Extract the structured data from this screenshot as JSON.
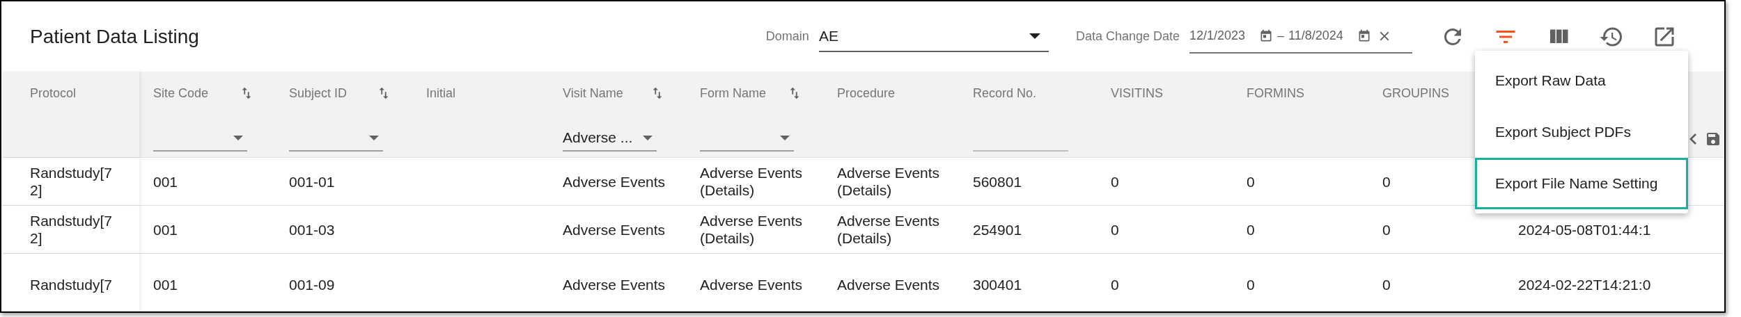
{
  "title": "Patient Data Listing",
  "toolbar": {
    "domain": {
      "label": "Domain",
      "value": "AE"
    },
    "date_range": {
      "label": "Data Change Date",
      "start": "12/1/2023",
      "separator": "–",
      "end": "11/8/2024"
    },
    "buttons": [
      {
        "kind": "refresh",
        "active": false
      },
      {
        "kind": "filter",
        "active": true
      },
      {
        "kind": "columns",
        "active": false
      },
      {
        "kind": "history",
        "active": false
      },
      {
        "kind": "export",
        "active": false
      }
    ]
  },
  "table": {
    "columns": [
      {
        "label": "Protocol",
        "sortable": false,
        "filter": {
          "kind": "none"
        }
      },
      {
        "label": "Site Code",
        "sortable": true,
        "filter": {
          "kind": "select"
        }
      },
      {
        "label": "Subject ID",
        "sortable": true,
        "filter": {
          "kind": "select"
        }
      },
      {
        "label": "Initial",
        "sortable": false,
        "filter": {
          "kind": "none"
        }
      },
      {
        "label": "Visit Name",
        "sortable": true,
        "filter": {
          "kind": "select",
          "value": "Adverse ..."
        }
      },
      {
        "label": "Form Name",
        "sortable": true,
        "filter": {
          "kind": "select"
        }
      },
      {
        "label": "Procedure",
        "sortable": false,
        "filter": {
          "kind": "none"
        }
      },
      {
        "label": "Record No.",
        "sortable": false,
        "filter": {
          "kind": "text"
        }
      },
      {
        "label": "VISITINS",
        "sortable": false,
        "filter": {
          "kind": "none"
        }
      },
      {
        "label": "FORMINS",
        "sortable": false,
        "filter": {
          "kind": "none"
        }
      },
      {
        "label": "GROUPINS",
        "sortable": false,
        "filter": {
          "kind": "none"
        }
      },
      {
        "sortable": false,
        "filter": {
          "kind": "actions"
        }
      }
    ],
    "rows": [
      {
        "cells": [
          "Randstudy[72]",
          "001",
          "001-01",
          null,
          "Adverse Events",
          "Adverse Events (Details)",
          "Adverse Events (Details)",
          "560801",
          "0",
          "0",
          "0",
          null
        ]
      },
      {
        "cells": [
          "Randstudy[72]",
          "001",
          "001-03",
          null,
          "Adverse Events",
          "Adverse Events (Details)",
          "Adverse Events (Details)",
          "254901",
          "0",
          "0",
          "0",
          "2024-05-08T01:44:1"
        ]
      },
      {
        "cells": [
          "Randstudy[7",
          "001",
          "001-09",
          null,
          "Adverse Events",
          "Adverse Events",
          "Adverse Events",
          "300401",
          "0",
          "0",
          "0",
          "2024-02-22T14:21:0"
        ]
      }
    ]
  },
  "export_menu": {
    "items": [
      {
        "label": "Export Raw Data",
        "selected": false
      },
      {
        "label": "Export Subject PDFs",
        "selected": false
      },
      {
        "label": "Export File Name Setting",
        "selected": true
      }
    ]
  }
}
